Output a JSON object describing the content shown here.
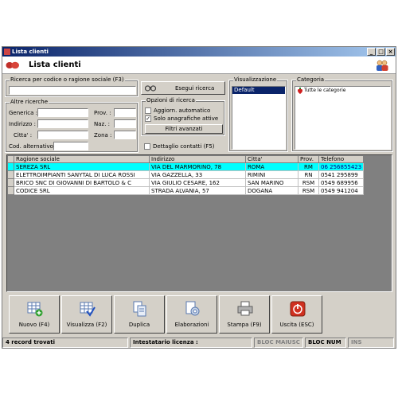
{
  "window": {
    "title": "Lista clienti"
  },
  "header": {
    "title": "Lista clienti"
  },
  "search": {
    "code_label": "Ricerca per codice o ragione sociale (F3)",
    "code_value": "",
    "run_button": "Esegui ricerca"
  },
  "other": {
    "legend": "Altre ricerche",
    "generica": "Generica :",
    "indirizzo": "Indirizzo :",
    "citta": "Citta' :",
    "cod_alt": "Cod. alternativo :",
    "prov": "Prov. :",
    "naz": "Naz. :",
    "zona": "Zona :"
  },
  "options": {
    "legend": "Opzioni di ricerca",
    "auto_update": "Aggiorn. automatico",
    "auto_update_checked": false,
    "only_active": "Solo anagrafiche attive",
    "only_active_checked": true,
    "advanced_filters": "Filtri avanzati",
    "contact_details": "Dettaglio contatti (F5)",
    "contact_details_checked": false
  },
  "view": {
    "legend": "Visualizzazione",
    "selected": "Default"
  },
  "category": {
    "legend": "Categoria",
    "item": "Tutte le categorie"
  },
  "table": {
    "headers": [
      "Ragione sociale",
      "Indirizzo",
      "Citta'",
      "Prov.",
      "Telefono"
    ],
    "rows": [
      [
        "SEREZA SRL",
        "VIA DEL MARMORINO, 78",
        "ROMA",
        "RM",
        "06 256855423"
      ],
      [
        "ELETTROIMPIANTI SANYTAL DI LUCA ROSSI",
        "VIA GAZZELLA, 33",
        "RIMINI",
        "RN",
        "0541 295899"
      ],
      [
        "BRICO SNC DI GIOVANNI DI BARTOLO & C",
        "VIA GIULIO CESARE, 162",
        "SAN MARINO",
        "RSM",
        "0549 689956"
      ],
      [
        "CODICE SRL",
        "STRADA ALVANIA, 57",
        "DOGANA",
        "RSM",
        "0549 941204"
      ]
    ],
    "selected_row": 0
  },
  "toolbar": {
    "new": "Nuovo (F4)",
    "view": "Visualizza (F2)",
    "duplicate": "Duplica",
    "elaborations": "Elaborazioni",
    "print": "Stampa (F9)",
    "exit": "Uscita (ESC)"
  },
  "status": {
    "records": "4 record trovati",
    "license": "Intestatario licenza :",
    "caps": "BLOC MAIUSC",
    "num": "BLOC NUM",
    "ins": "INS"
  },
  "colors": {
    "title_start": "#0a246a",
    "title_end": "#a6caf0",
    "selected_row": "#00ffff",
    "face": "#d4d0c8"
  }
}
